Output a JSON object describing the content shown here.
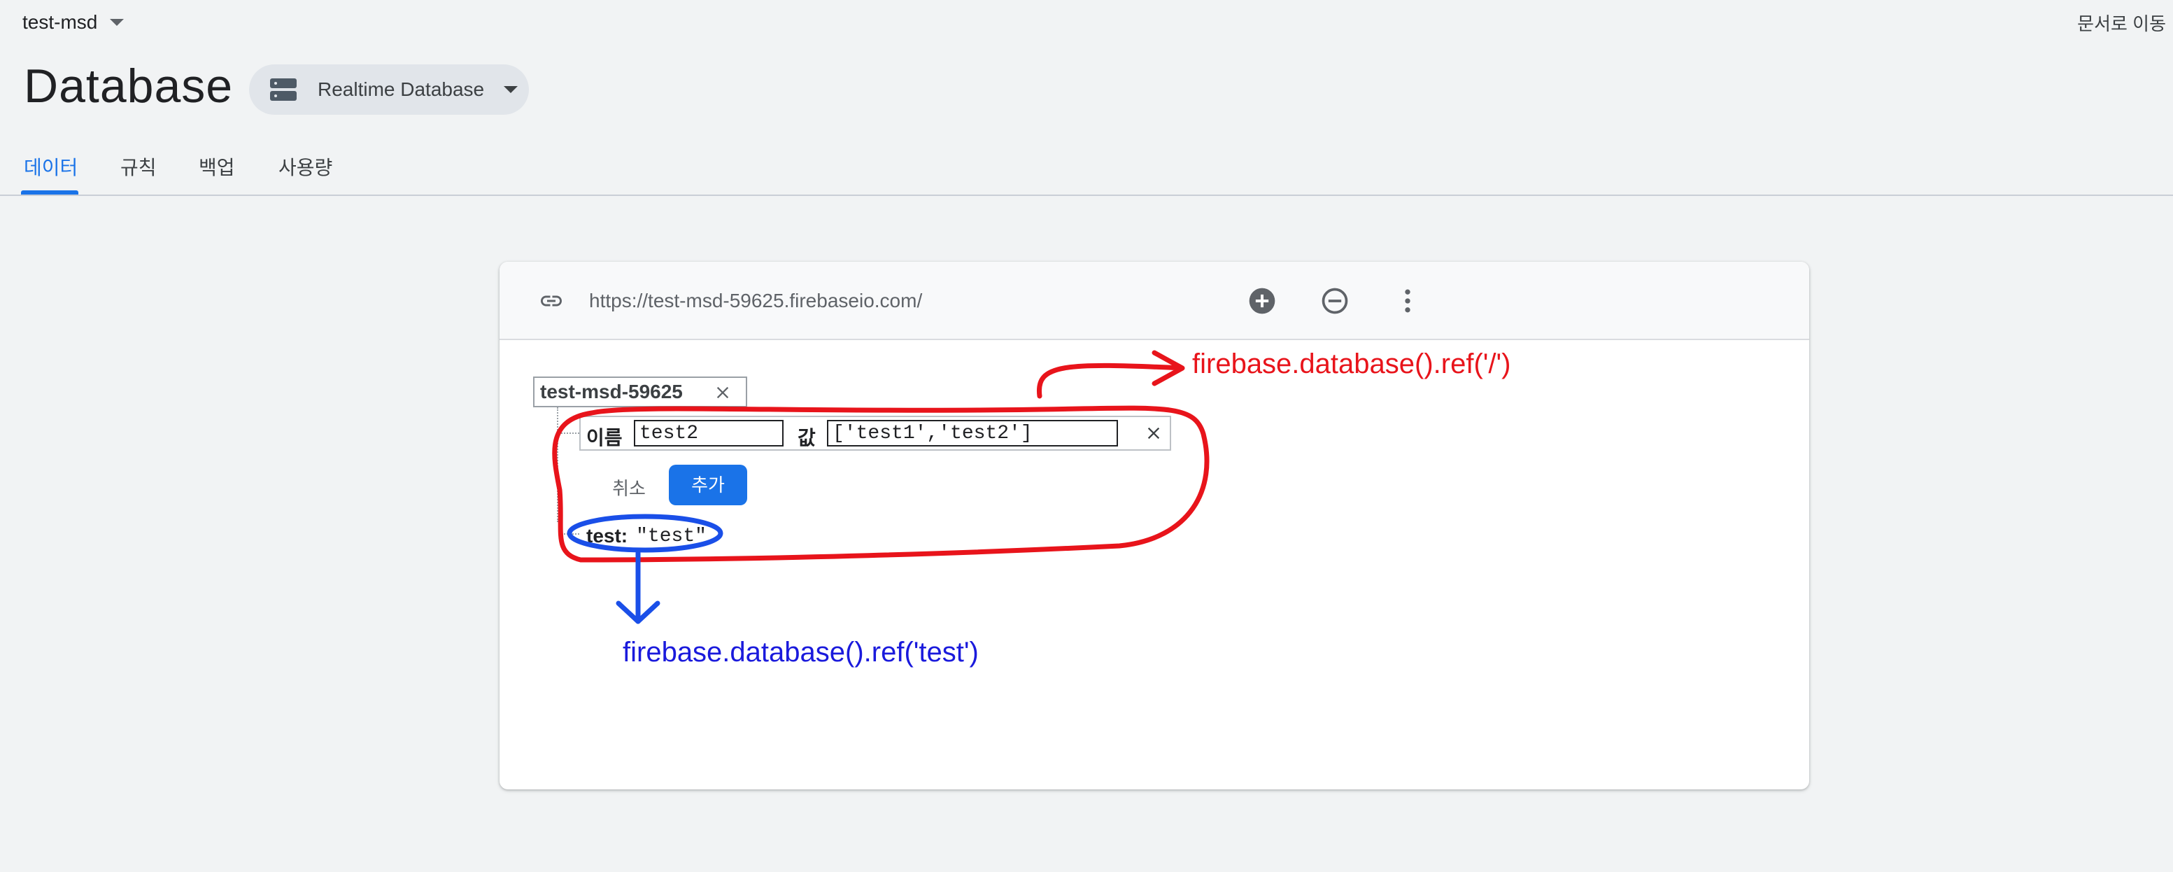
{
  "header": {
    "project_name": "test-msd",
    "docs_link": "문서로 이동",
    "page_title": "Database",
    "db_selector_label": "Realtime Database"
  },
  "tabs": [
    {
      "label": "데이터",
      "active": true
    },
    {
      "label": "규칙",
      "active": false
    },
    {
      "label": "백업",
      "active": false
    },
    {
      "label": "사용량",
      "active": false
    }
  ],
  "card": {
    "url": "https://test-msd-59625.firebaseio.com/",
    "root_node": "test-msd-59625",
    "add_form": {
      "name_label": "이름",
      "name_value": "test2",
      "value_label": "값",
      "value_value": "['test1','test2']",
      "cancel_label": "취소",
      "add_label": "추가"
    },
    "child": {
      "key": "test:",
      "value": "\"test\""
    }
  },
  "annotations": {
    "red_text": "firebase.database().ref('/')",
    "blue_text": "firebase.database().ref('test')",
    "red_color": "#e8141b",
    "blue_color": "#1a1adc"
  },
  "icons": [
    "chevron-down-icon",
    "database-icon",
    "link-icon",
    "add-circle-icon",
    "remove-circle-icon",
    "more-vert-icon",
    "close-icon"
  ],
  "colors": {
    "accent": "#1a73e8",
    "background": "#f1f3f4"
  }
}
